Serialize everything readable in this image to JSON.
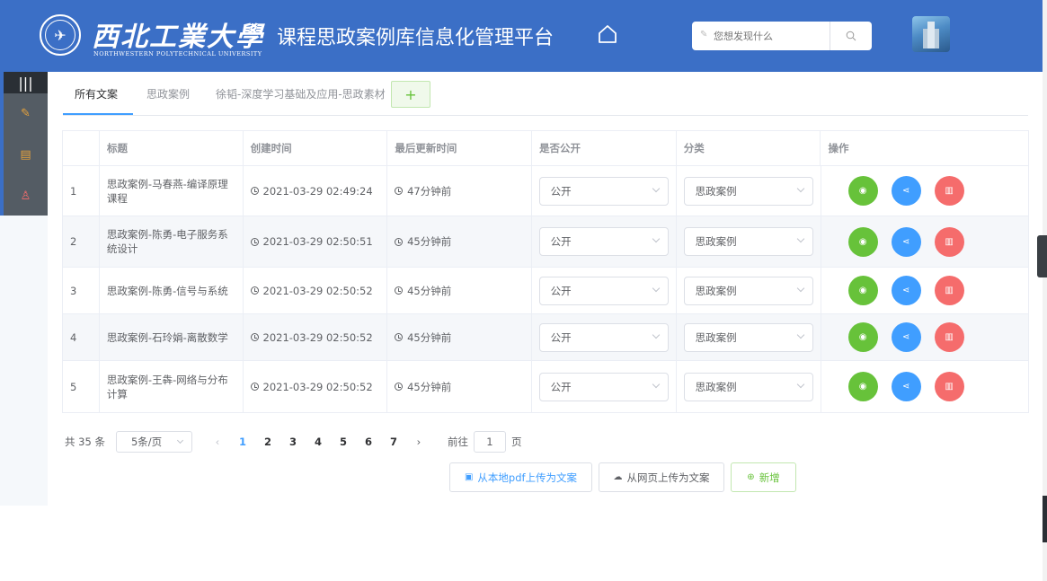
{
  "header": {
    "logo_cn": "西北工業大學",
    "logo_en": "NORTHWESTERN POLYTECHNICAL UNIVERSITY",
    "title": "课程思政案例库信息化管理平台",
    "search_placeholder": "您想发现什么",
    "home_icon": "home-icon",
    "search_icon": "search-icon"
  },
  "sidebar": {
    "toggle": "|||",
    "items": [
      {
        "icon": "edit-icon",
        "glyph": "✎"
      },
      {
        "icon": "document-icon",
        "glyph": "▤"
      },
      {
        "icon": "user-icon",
        "glyph": "♙"
      }
    ]
  },
  "tabs": {
    "items": [
      "所有文案",
      "思政案例",
      "徐韬-深度学习基础及应用-思政素材"
    ],
    "active": 0,
    "add": "+"
  },
  "table": {
    "columns": [
      "",
      "标题",
      "创建时间",
      "最后更新时间",
      "是否公开",
      "分类",
      "操作"
    ],
    "rows": [
      {
        "index": "1",
        "title": "思政案例-马春燕-编译原理课程",
        "created": "2021-03-29 02:49:24",
        "updated": "47分钟前",
        "public": "公开",
        "category": "思政案例"
      },
      {
        "index": "2",
        "title": "思政案例-陈勇-电子服务系统设计",
        "created": "2021-03-29 02:50:51",
        "updated": "45分钟前",
        "public": "公开",
        "category": "思政案例"
      },
      {
        "index": "3",
        "title": "思政案例-陈勇-信号与系统",
        "created": "2021-03-29 02:50:52",
        "updated": "45分钟前",
        "public": "公开",
        "category": "思政案例"
      },
      {
        "index": "4",
        "title": "思政案例-石玲娟-离散数学",
        "created": "2021-03-29 02:50:52",
        "updated": "45分钟前",
        "public": "公开",
        "category": "思政案例"
      },
      {
        "index": "5",
        "title": "思政案例-王犇-网络与分布计算",
        "created": "2021-03-29 02:50:52",
        "updated": "45分钟前",
        "public": "公开",
        "category": "思政案例"
      }
    ],
    "actions": {
      "view_icon": "eye-icon",
      "share_icon": "share-icon",
      "delete_icon": "trash-icon"
    }
  },
  "pagination": {
    "total": "共 35 条",
    "page_size": "5条/页",
    "pages": [
      "1",
      "2",
      "3",
      "4",
      "5",
      "6",
      "7"
    ],
    "current": "1",
    "goto_prefix": "前往",
    "goto_value": "1",
    "goto_suffix": "页"
  },
  "buttons": {
    "upload_pdf": "从本地pdf上传为文案",
    "upload_web": "从网页上传为文案",
    "add_new": "新增"
  },
  "colors": {
    "header": "#3b6fc6",
    "primary": "#409eff",
    "success": "#67c23a",
    "danger": "#f56c6c"
  }
}
